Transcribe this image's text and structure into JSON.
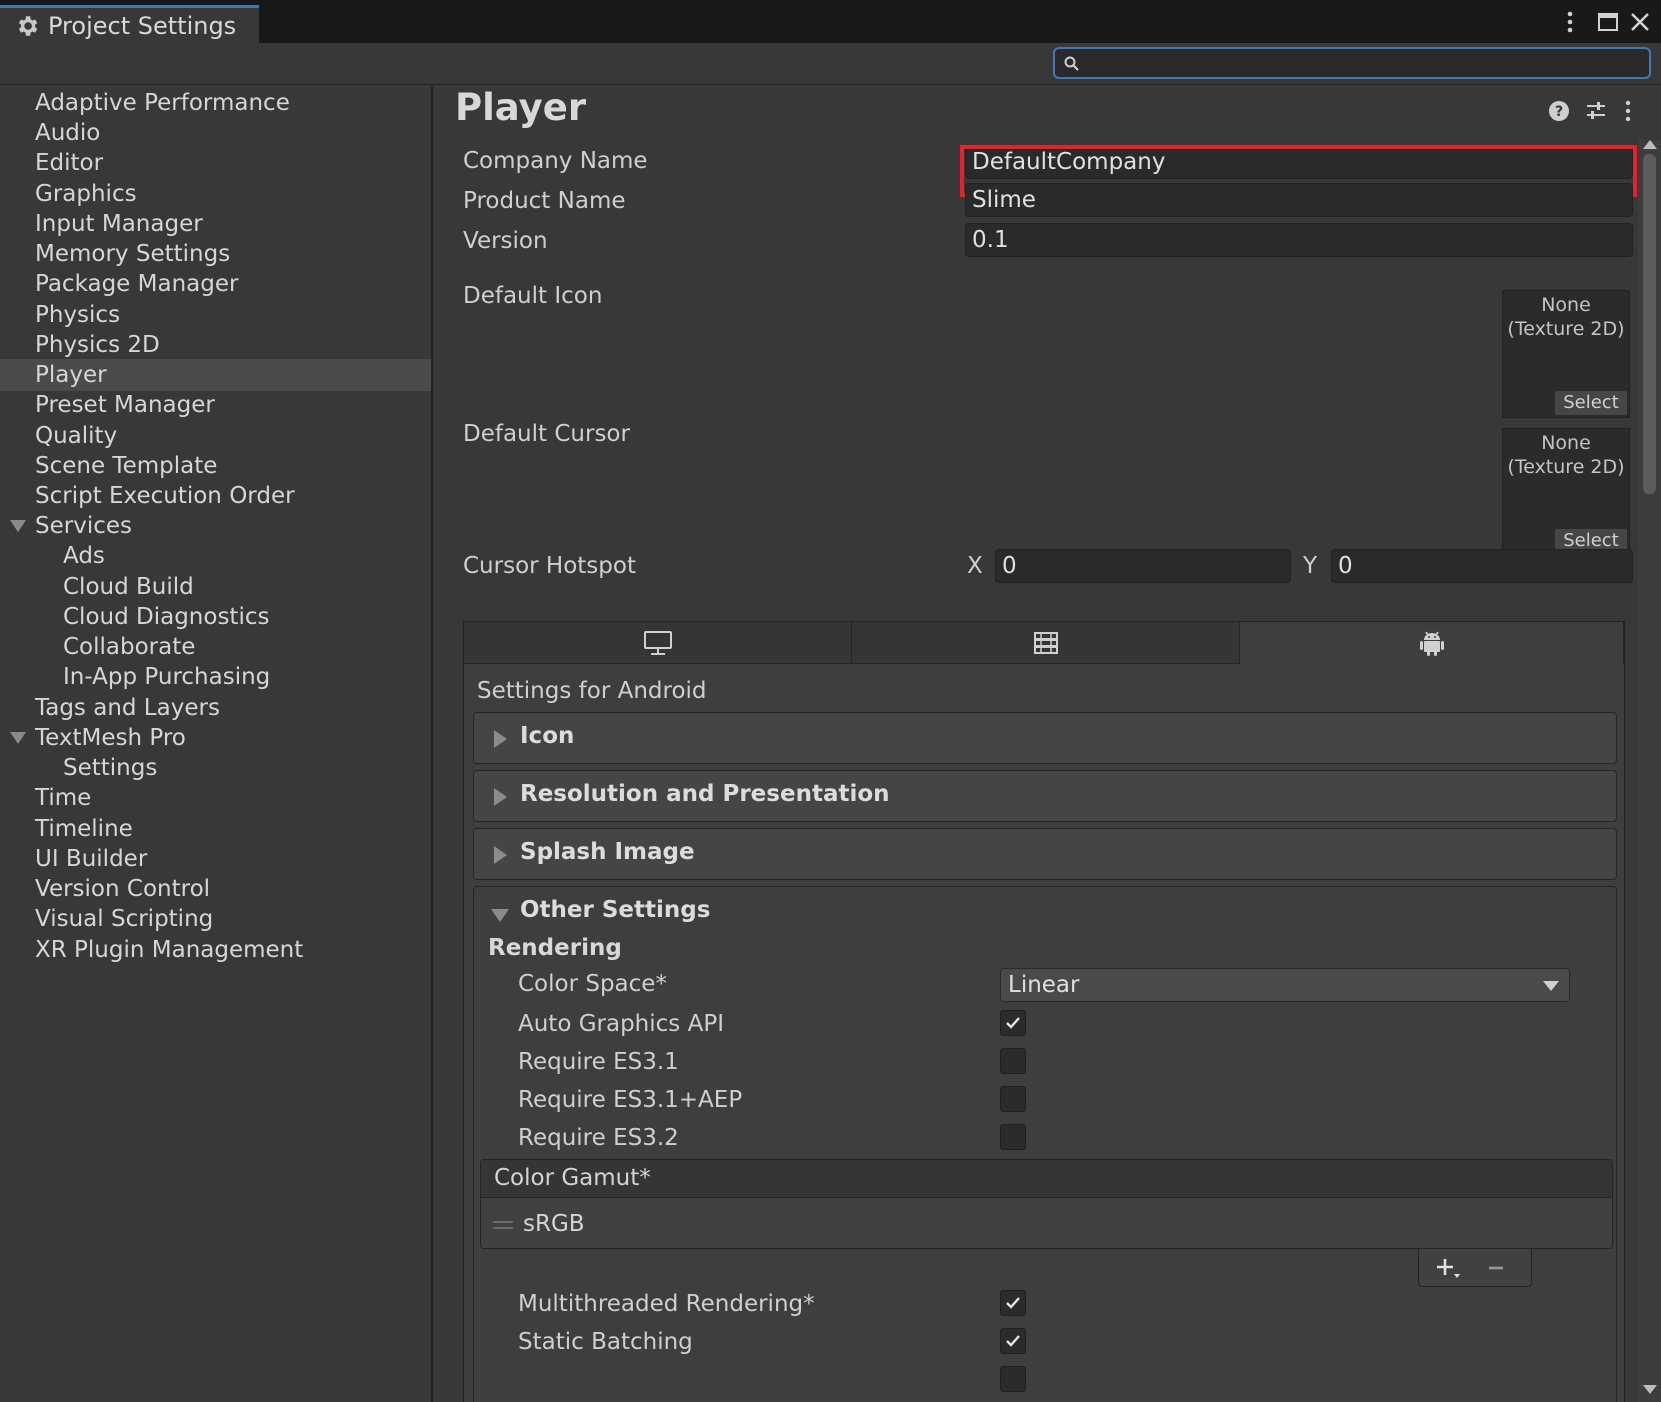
{
  "window": {
    "tab_title": "Project Settings"
  },
  "search": {
    "value": "",
    "placeholder": ""
  },
  "sidebar": {
    "items": [
      {
        "label": "Adaptive Performance"
      },
      {
        "label": "Audio"
      },
      {
        "label": "Editor"
      },
      {
        "label": "Graphics"
      },
      {
        "label": "Input Manager"
      },
      {
        "label": "Memory Settings"
      },
      {
        "label": "Package Manager"
      },
      {
        "label": "Physics"
      },
      {
        "label": "Physics 2D"
      },
      {
        "label": "Player",
        "selected": true
      },
      {
        "label": "Preset Manager"
      },
      {
        "label": "Quality"
      },
      {
        "label": "Scene Template"
      },
      {
        "label": "Script Execution Order"
      },
      {
        "label": "Services",
        "expanded": true
      },
      {
        "label": "Ads"
      },
      {
        "label": "Cloud Build"
      },
      {
        "label": "Cloud Diagnostics"
      },
      {
        "label": "Collaborate"
      },
      {
        "label": "In-App Purchasing"
      },
      {
        "label": "Tags and Layers"
      },
      {
        "label": "TextMesh Pro",
        "expanded": true
      },
      {
        "label": "Settings"
      },
      {
        "label": "Time"
      },
      {
        "label": "Timeline"
      },
      {
        "label": "UI Builder"
      },
      {
        "label": "Version Control"
      },
      {
        "label": "Visual Scripting"
      },
      {
        "label": "XR Plugin Management"
      }
    ]
  },
  "main": {
    "title": "Player",
    "company_name_label": "Company Name",
    "company_name_value": "DefaultCompany",
    "product_name_label": "Product Name",
    "product_name_value": "Slime",
    "version_label": "Version",
    "version_value": "0.1",
    "default_icon_label": "Default Icon",
    "default_cursor_label": "Default Cursor",
    "texture_none": "None",
    "texture_type": "(Texture 2D)",
    "select_label": "Select",
    "cursor_hotspot_label": "Cursor Hotspot",
    "hotspot_x_label": "X",
    "hotspot_x_value": "0",
    "hotspot_y_label": "Y",
    "hotspot_y_value": "0",
    "highlight_color": "#e5212b"
  },
  "platform": {
    "tabs": [
      {
        "icon": "monitor-icon"
      },
      {
        "icon": "server-icon"
      },
      {
        "icon": "android-icon",
        "active": true
      }
    ],
    "settings_for": "Settings for Android",
    "sections": {
      "icon": "Icon",
      "resolution": "Resolution and Presentation",
      "splash": "Splash Image",
      "other": "Other Settings"
    },
    "other": {
      "rendering_header": "Rendering",
      "color_space_label": "Color Space*",
      "color_space_value": "Linear",
      "auto_graphics_label": "Auto Graphics API",
      "auto_graphics_checked": true,
      "es31_label": "Require ES3.1",
      "es31_checked": false,
      "es31aep_label": "Require ES3.1+AEP",
      "es31aep_checked": false,
      "es32_label": "Require ES3.2",
      "es32_checked": false,
      "color_gamut_label": "Color Gamut*",
      "color_gamut_items": [
        "sRGB"
      ],
      "multithreaded_label": "Multithreaded Rendering*",
      "multithreaded_checked": true,
      "static_batching_label": "Static Batching",
      "static_batching_checked": true
    }
  },
  "colors": {
    "accent": "#3a79bb",
    "background": "#383838"
  }
}
